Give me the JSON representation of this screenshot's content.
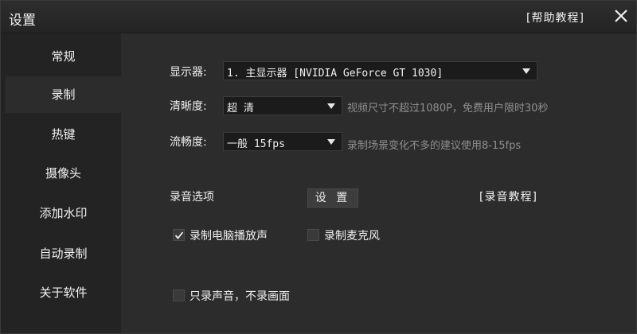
{
  "window": {
    "title": "设置",
    "help_link": "[帮助教程]",
    "close_icon": "close-icon"
  },
  "sidebar": {
    "items": [
      {
        "label": "常规",
        "active": false
      },
      {
        "label": "录制",
        "active": true
      },
      {
        "label": "热键",
        "active": false
      },
      {
        "label": "摄像头",
        "active": false
      },
      {
        "label": "添加水印",
        "active": false
      },
      {
        "label": "自动录制",
        "active": false
      },
      {
        "label": "关于软件",
        "active": false
      }
    ]
  },
  "main": {
    "display": {
      "label": "显示器:",
      "value": "1. 主显示器 [NVIDIA GeForce GT 1030]"
    },
    "clarity": {
      "label": "清晰度:",
      "value": "超 清",
      "hint": "视频尺寸不超过1080P，免费用户限时30秒"
    },
    "fluency": {
      "label": "流畅度:",
      "value": "一般 15fps",
      "hint": "录制场景变化不多的建议使用8-15fps"
    },
    "audio": {
      "label": "录音选项",
      "settings_button": "设 置",
      "tutorial_link": "[录音教程]"
    },
    "checkboxes": {
      "record_system_sound": {
        "label": "录制电脑播放声",
        "checked": true
      },
      "record_mic": {
        "label": "录制麦克风",
        "checked": false
      },
      "audio_only": {
        "label": "只录声音，不录画面",
        "checked": false
      }
    }
  },
  "colors": {
    "background": "#2c2c2c",
    "sidebar": "#232323",
    "titlebar": "#242424",
    "text": "#f0f0f0",
    "hint": "#8f8f8f",
    "select_bg": "#1b1b1b"
  }
}
